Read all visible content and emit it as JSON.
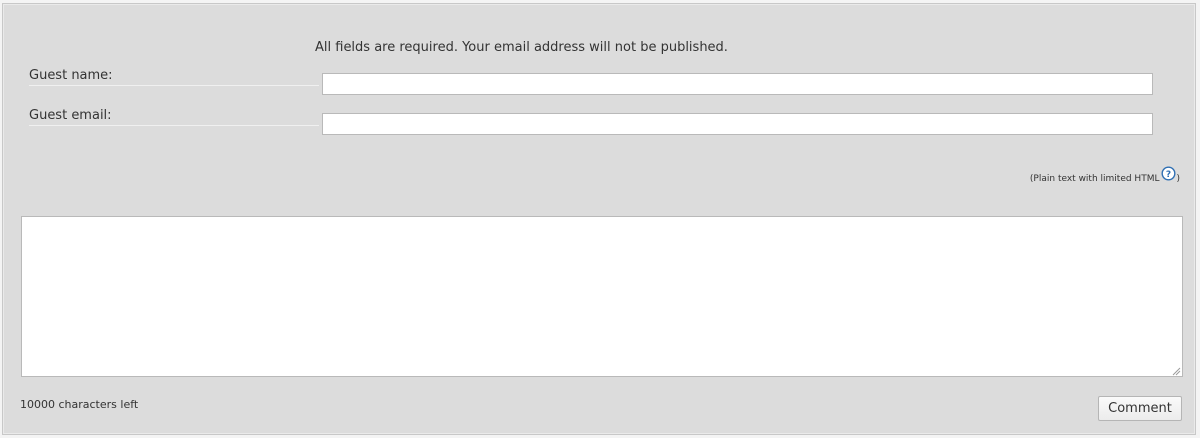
{
  "form": {
    "notice": "All fields are required. Your email address will not be published.",
    "guest_name_label": "Guest name:",
    "guest_name_value": "",
    "guest_email_label": "Guest email:",
    "guest_email_value": "",
    "format_hint_prefix": "(Plain text with limited HTML",
    "format_hint_suffix": ")",
    "help_icon": "question-circle-icon",
    "comment_value": "",
    "chars_left": "10000 characters left",
    "submit_label": "Comment"
  },
  "colors": {
    "panel_bg": "#dcdcdc",
    "help_icon": "#2f6fb3"
  }
}
